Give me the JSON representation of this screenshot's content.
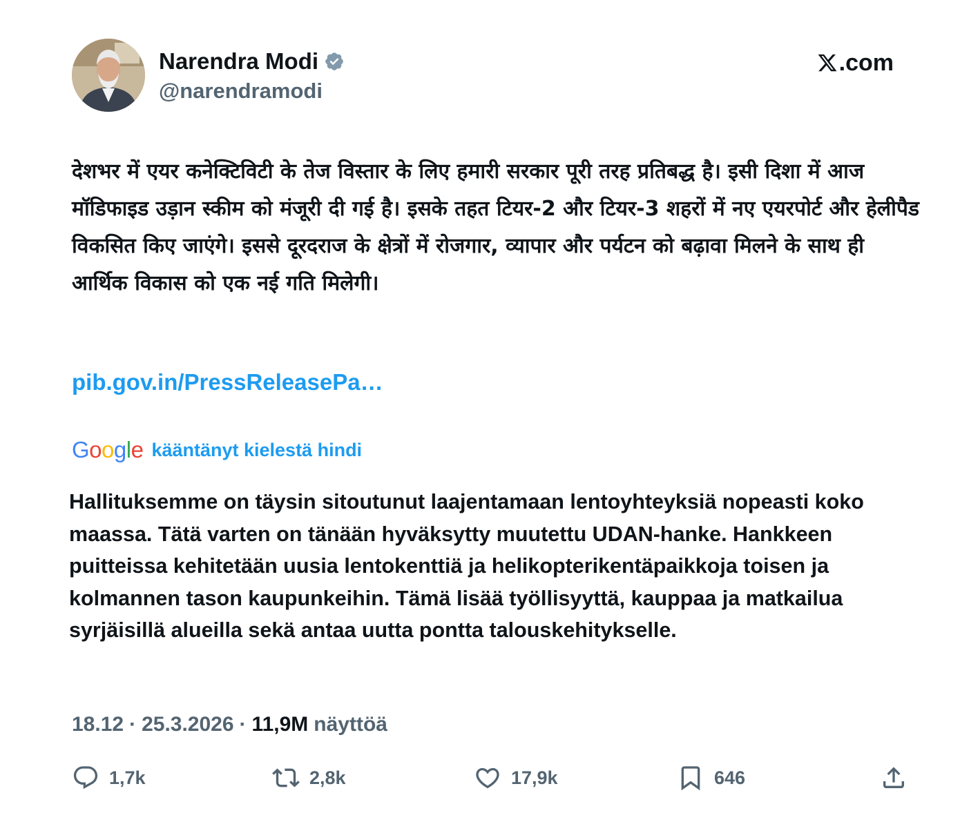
{
  "author": {
    "name": "Narendra Modi",
    "handle": "@narendramodi",
    "verified_color": "#829aab"
  },
  "brand": {
    "text": ".com",
    "logo_icon": "x-logo-icon"
  },
  "tweet": {
    "text": "देशभर में एयर कनेक्टिविटी के तेज विस्तार के लिए हमारी सरकार पूरी तरह प्रतिबद्ध है। इसी दिशा में आज मॉडिफाइड उड़ान स्कीम को मंजूरी दी गई है। इसके तहत टियर-2 और टियर-3 शहरों में नए एयरपोर्ट और हेलीपैड विकसित किए जाएंगे। इससे दूरदराज के क्षेत्रों में रोजगार, व्यापार और पर्यटन को बढ़ावा मिलने के साथ ही आर्थिक विकास को एक नई गति मिलेगी।",
    "link": "pib.gov.in/PressReleasePa…"
  },
  "translation": {
    "provider": "Google",
    "label": "kääntänyt kielestä hindi",
    "text": "Hallituksemme on täysin sitoutunut laajentamaan lentoyhteyksiä nopeasti koko maassa. Tätä varten on tänään hyväksytty muutettu UDAN-hanke. Hankkeen puitteissa kehitetään uusia lentokenttiä ja helikopterikentäpaikkoja toisen ja kolmannen tason kaupunkeihin. Tämä lisää työllisyyttä, kauppaa ja matkailua syrjäisillä alueilla sekä antaa uutta pontta talouskehitykselle."
  },
  "meta": {
    "time": "18.12",
    "date": "25.3.2026",
    "separator": "·",
    "views": "11,9M",
    "views_label": "näyttöä"
  },
  "actions": {
    "replies": "1,7k",
    "reposts": "2,8k",
    "likes": "17,9k",
    "bookmarks": "646"
  },
  "colors": {
    "text": "#0f1419",
    "secondary": "#536471",
    "link": "#1d9bf0",
    "google_blue": "#4285f4",
    "google_red": "#ea4335",
    "google_yellow": "#fbbc05",
    "google_green": "#34a853"
  }
}
